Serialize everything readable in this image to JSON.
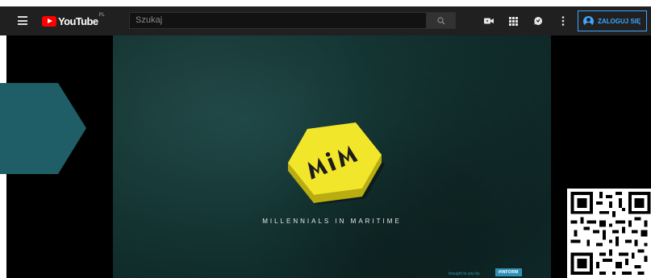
{
  "header": {
    "logo_text": "YouTube",
    "logo_country": "PL",
    "search_placeholder": "Szukaj",
    "signin_label": "ZALOGUJ SIĘ"
  },
  "video": {
    "tagline": "MILLENNIALS IN MARITIME",
    "brought_by": "brought to you by",
    "sponsor": "#INFORM",
    "logo_text": "MiM"
  },
  "icons": {
    "menu": "menu-icon",
    "search": "search-icon",
    "upload": "video-camera-icon",
    "apps": "apps-grid-icon",
    "messages": "chat-icon",
    "more": "more-vert-icon",
    "account": "account-icon"
  },
  "colors": {
    "header_bg": "#202020",
    "accent": "#3ea6ff",
    "brand_red": "#ff0000",
    "video_bg": "#153735",
    "hexagon": "#f2e62a",
    "arrow": "#1f5e66"
  }
}
